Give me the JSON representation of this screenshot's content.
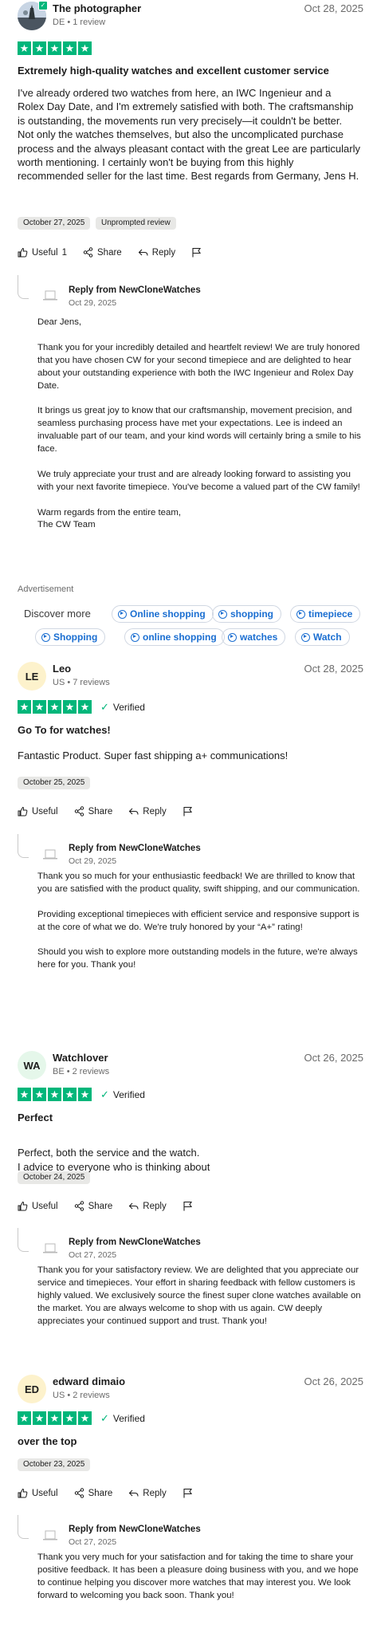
{
  "colors": {
    "star_green": "#00b67a",
    "link_blue": "#1a6ed1",
    "chip_bg": "#e8e8e6"
  },
  "icons": [
    "thumbs-up-icon",
    "share-icon",
    "reply-icon",
    "flag-icon",
    "star-icon",
    "verified-check-icon",
    "company-logo-icon"
  ],
  "actions": {
    "useful": "Useful",
    "share": "Share",
    "reply": "Reply"
  },
  "reviews": [
    {
      "name": "The photographer",
      "meta": "DE • 1 review",
      "date": "Oct 28, 2025",
      "rating": 5,
      "title": "Extremely high-quality watches and excellent customer service",
      "body": [
        "I've already ordered two watches from here, an IWC Ingenieur and a Rolex Day Date, and I'm extremely satisfied with both. The craftsmanship is outstanding, the movements run very precisely—it couldn't be better. Not only the watches themselves, but also the uncomplicated purchase process and the always pleasant contact with the great Lee are particularly worth mentioning. I certainly won't be buying from this highly recommended seller for the last time. Best regards from Germany, Jens H."
      ],
      "experience_date": "October 27, 2025",
      "tag": "Unprompted review",
      "useful_count": "1",
      "reply": {
        "from": "Reply from NewCloneWatches",
        "date": "Oct 29, 2025",
        "paragraphs": [
          "Dear Jens,",
          "Thank you for your incredibly detailed and heartfelt review! We are truly honored that you have chosen CW for your second timepiece and are delighted to hear about your outstanding experience with both the IWC Ingenieur and Rolex Day Date.",
          "It brings us great joy to know that our craftsmanship, movement precision, and seamless purchasing process have met your expectations. Lee is indeed an invaluable part of our team, and your kind words will certainly bring a smile to his face.",
          "We truly appreciate your trust and are already looking forward to assisting you with your next favorite timepiece. You've become a valued part of the CW family!",
          "Warm regards from the entire team,\nThe CW Team"
        ]
      }
    },
    {
      "initials": "LE",
      "name": "Leo",
      "meta": "US • 7 reviews",
      "date": "Oct 28, 2025",
      "rating": 5,
      "verified": "Verified",
      "title": "Go To for watches!",
      "body": [
        "Fantastic Product. Super fast shipping a+ communications!"
      ],
      "experience_date": "October 25, 2025",
      "reply": {
        "from": "Reply from NewCloneWatches",
        "date": "Oct 29, 2025",
        "paragraphs": [
          "Thank you so much for your enthusiastic feedback! We are thrilled to know that you are satisfied with the product quality, swift shipping, and our communication.",
          "Providing exceptional timepieces with efficient service and responsive support is at the core of what we do. We're truly honored by your “A+” rating!",
          "Should you wish to explore more outstanding models in the future, we're always here for you. Thank you!"
        ]
      }
    },
    {
      "initials": "WA",
      "name": "Watchlover",
      "meta": "BE • 2 reviews",
      "date": "Oct 26, 2025",
      "rating": 5,
      "verified": "Verified",
      "title": "Perfect",
      "body": [
        "Perfect, both the service and the watch.\nI advice to everyone who is thinking about"
      ],
      "experience_date": "October 24, 2025",
      "reply": {
        "from": "Reply from NewCloneWatches",
        "date": "Oct 27, 2025",
        "paragraphs": [
          "Thank you for your satisfactory review. We are delighted that you appreciate our service and timepieces. Your effort in sharing feedback with fellow customers is highly valued. We exclusively source the finest super clone watches available on the market. You are always welcome to shop with us again. CW deeply appreciates your continued support and trust. Thank you!"
        ]
      }
    },
    {
      "initials": "ED",
      "name": "edward dimaio",
      "meta": "US • 2 reviews",
      "date": "Oct 26, 2025",
      "rating": 5,
      "verified": "Verified",
      "title": "over the top",
      "body": [],
      "experience_date": "October 23, 2025",
      "reply": {
        "from": "Reply from NewCloneWatches",
        "date": "Oct 27, 2025",
        "paragraphs": [
          "Thank you very much for your satisfaction and for taking the time to share your positive feedback. It has been a pleasure doing business with you, and we hope to continue helping you discover more watches that may interest you. We look forward to welcoming you back soon. Thank you!"
        ]
      }
    }
  ],
  "advertisement": {
    "label": "Advertisement",
    "discover": "Discover more",
    "links": [
      "Online shopping",
      "shopping",
      "timepiece",
      "Shopping",
      "online shopping",
      "watches",
      "Watch"
    ]
  }
}
